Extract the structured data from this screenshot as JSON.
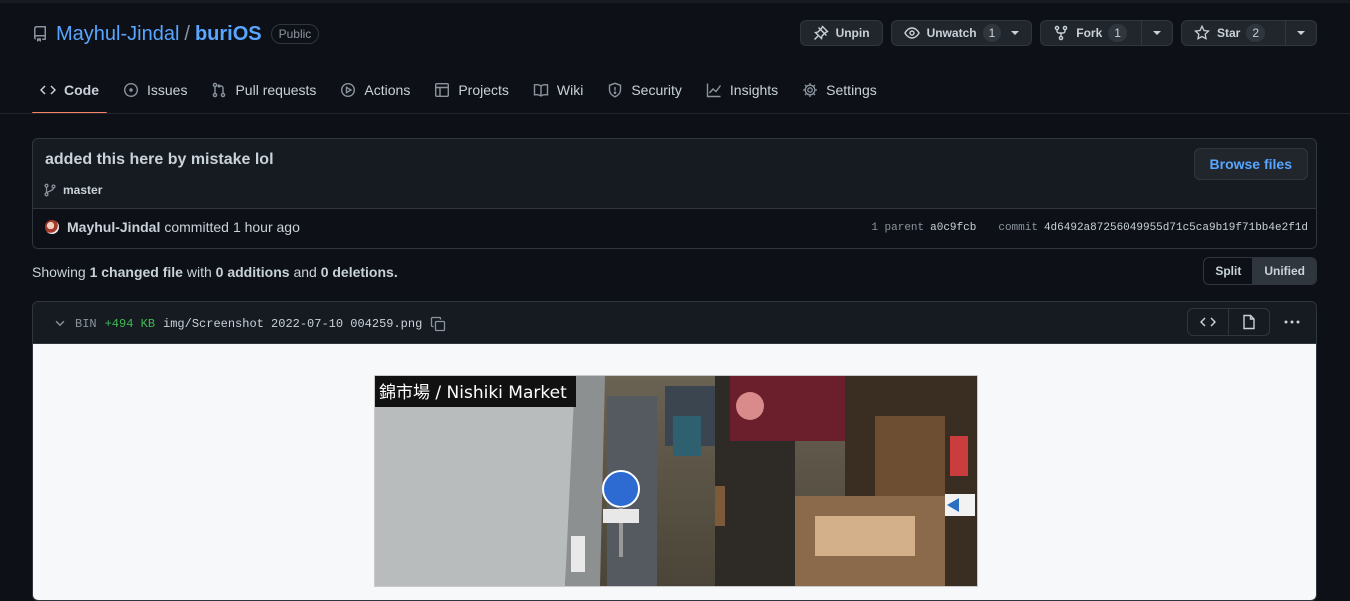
{
  "repo": {
    "owner": "Mayhul-Jindal",
    "separator": "/",
    "name": "buriOS",
    "visibility": "Public"
  },
  "actions": {
    "unpin": "Unpin",
    "unwatch": "Unwatch",
    "unwatch_count": "1",
    "fork": "Fork",
    "fork_count": "1",
    "star": "Star",
    "star_count": "2"
  },
  "tabs": [
    {
      "label": "Code",
      "icon": "code-icon",
      "active": true
    },
    {
      "label": "Issues",
      "icon": "issue-opened-icon"
    },
    {
      "label": "Pull requests",
      "icon": "git-pull-request-icon"
    },
    {
      "label": "Actions",
      "icon": "play-icon"
    },
    {
      "label": "Projects",
      "icon": "table-icon"
    },
    {
      "label": "Wiki",
      "icon": "book-icon"
    },
    {
      "label": "Security",
      "icon": "shield-icon"
    },
    {
      "label": "Insights",
      "icon": "graph-icon"
    },
    {
      "label": "Settings",
      "icon": "gear-icon"
    }
  ],
  "commit": {
    "message": "added this here by mistake lol",
    "branch": "master",
    "browse_label": "Browse files",
    "author": "Mayhul-Jindal",
    "action": "committed",
    "time": "1 hour ago",
    "parent_label": "1 parent",
    "parent_sha": "a0c9fcb",
    "commit_label": "commit",
    "commit_sha": "4d6492a87256049955d71c5ca9b19f71bb4e2f1d"
  },
  "stats": {
    "showing": "Showing",
    "files": "1 changed file",
    "with": "with",
    "additions": "0 additions",
    "and": "and",
    "deletions": "0 deletions",
    "end": "."
  },
  "diff_view": {
    "split": "Split",
    "unified": "Unified",
    "selected": "Unified"
  },
  "file": {
    "type": "BIN",
    "size_change": "+494 KB",
    "path": "img/Screenshot 2022-07-10 004259.png",
    "image_caption": "錦市場 / Nishiki Market"
  },
  "colors": {
    "accent": "#58a6ff",
    "tab_underline": "#f78166",
    "addition": "#3fb950",
    "background": "#0d1117"
  }
}
